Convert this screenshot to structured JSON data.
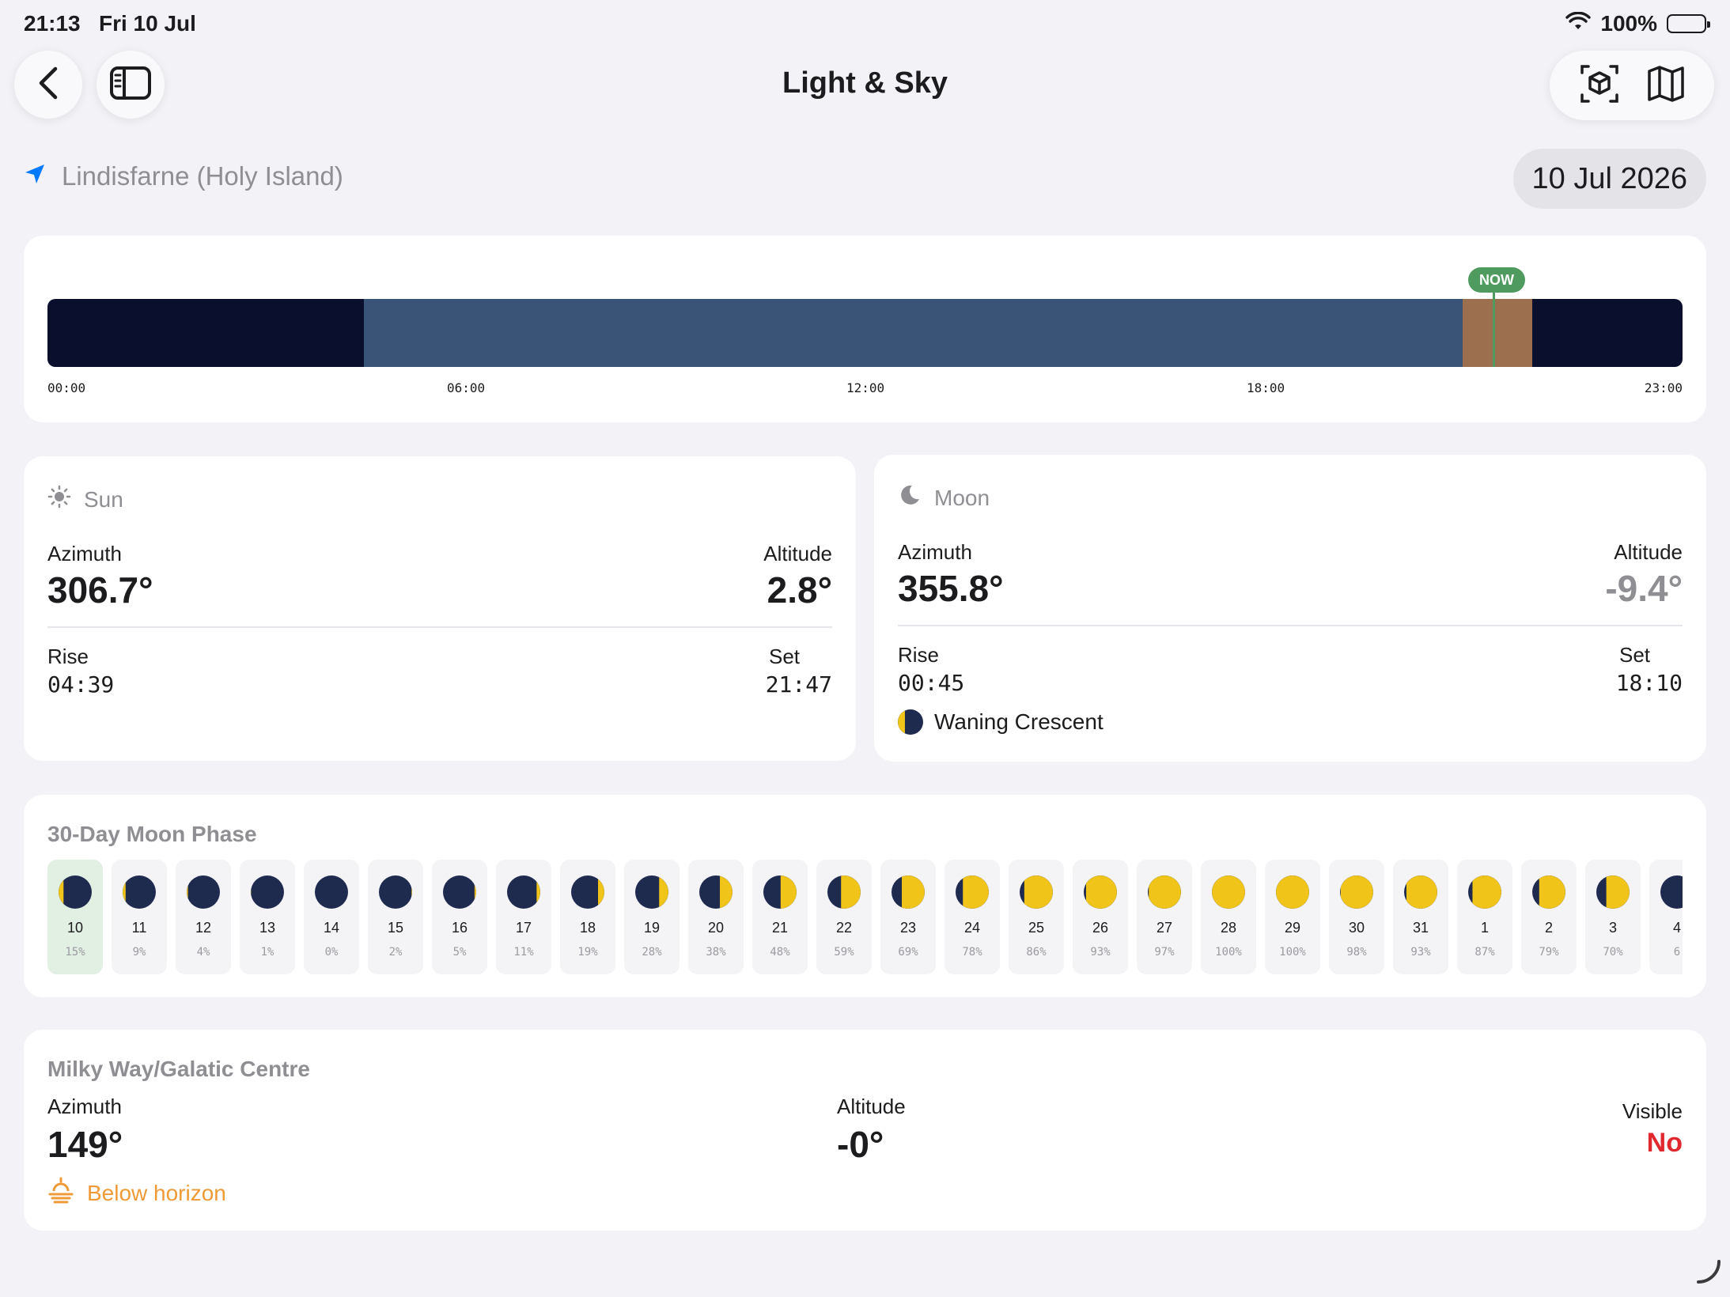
{
  "status": {
    "time": "21:13",
    "date": "Fri 10 Jul",
    "battery": "100%"
  },
  "nav": {
    "title": "Light & Sky"
  },
  "location": {
    "name": "Lindisfarne (Holy Island)",
    "date": "10 Jul 2026"
  },
  "timeline": {
    "now_label": "NOW",
    "ticks": [
      "00:00",
      "06:00",
      "12:00",
      "18:00",
      "23:00"
    ],
    "segment_colors": {
      "night": "#0b0f2e",
      "day": "#3a5477",
      "golden": "#9c6f4e"
    }
  },
  "sun": {
    "title": "Sun",
    "azimuth_label": "Azimuth",
    "azimuth": "306.7°",
    "altitude_label": "Altitude",
    "altitude": "2.8°",
    "rise_label": "Rise",
    "rise": "04:39",
    "set_label": "Set",
    "set": "21:47"
  },
  "moon": {
    "title": "Moon",
    "azimuth_label": "Azimuth",
    "azimuth": "355.8°",
    "altitude_label": "Altitude",
    "altitude": "-9.4°",
    "rise_label": "Rise",
    "rise": "00:45",
    "set_label": "Set",
    "set": "18:10",
    "phase_name": "Waning Crescent"
  },
  "moon_phase": {
    "title": "30-Day Moon Phase",
    "days": [
      {
        "day": "10",
        "pct": "15%",
        "selected": true
      },
      {
        "day": "11",
        "pct": "9%"
      },
      {
        "day": "12",
        "pct": "4%"
      },
      {
        "day": "13",
        "pct": "1%"
      },
      {
        "day": "14",
        "pct": "0%"
      },
      {
        "day": "15",
        "pct": "2%"
      },
      {
        "day": "16",
        "pct": "5%"
      },
      {
        "day": "17",
        "pct": "11%"
      },
      {
        "day": "18",
        "pct": "19%"
      },
      {
        "day": "19",
        "pct": "28%"
      },
      {
        "day": "20",
        "pct": "38%"
      },
      {
        "day": "21",
        "pct": "48%"
      },
      {
        "day": "22",
        "pct": "59%"
      },
      {
        "day": "23",
        "pct": "69%"
      },
      {
        "day": "24",
        "pct": "78%"
      },
      {
        "day": "25",
        "pct": "86%"
      },
      {
        "day": "26",
        "pct": "93%"
      },
      {
        "day": "27",
        "pct": "97%"
      },
      {
        "day": "28",
        "pct": "100%"
      },
      {
        "day": "29",
        "pct": "100%"
      },
      {
        "day": "30",
        "pct": "98%"
      },
      {
        "day": "31",
        "pct": "93%"
      },
      {
        "day": "1",
        "pct": "87%"
      },
      {
        "day": "2",
        "pct": "79%"
      },
      {
        "day": "3",
        "pct": "70%"
      },
      {
        "day": "4",
        "pct": "6"
      }
    ]
  },
  "milky_way": {
    "title": "Milky Way/Galatic Centre",
    "azimuth_label": "Azimuth",
    "azimuth": "149°",
    "altitude_label": "Altitude",
    "altitude": "-0°",
    "visible_label": "Visible",
    "visible": "No",
    "horizon_status": "Below horizon"
  },
  "colors": {
    "accent": "#007aff",
    "warning": "#f09a37",
    "negative": "#e0282e",
    "now": "#4f9a5f"
  }
}
